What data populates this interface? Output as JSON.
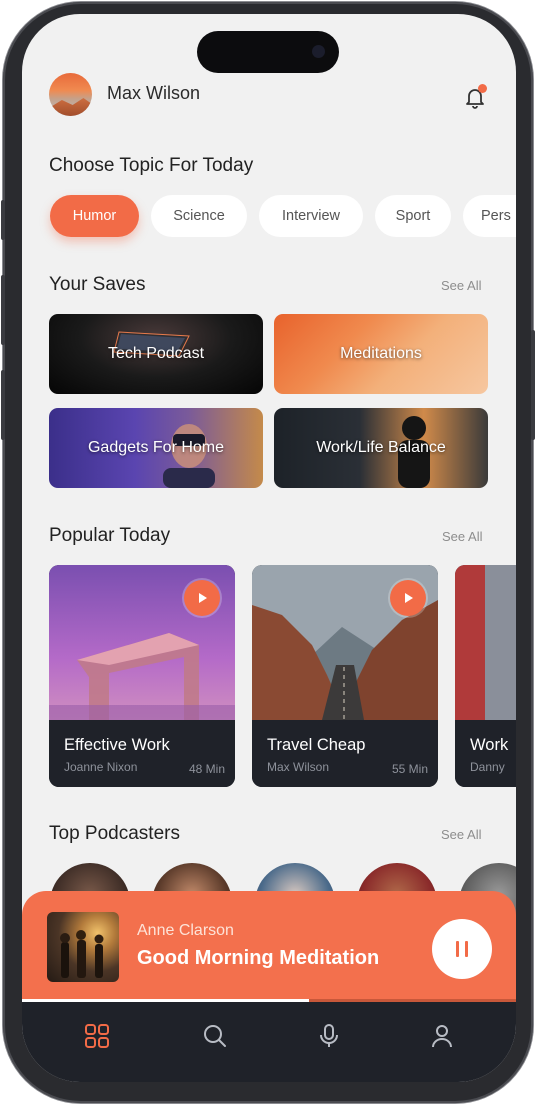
{
  "user": {
    "name": "Max Wilson"
  },
  "topics": {
    "title": "Choose Topic For Today",
    "items": [
      "Humor",
      "Science",
      "Interview",
      "Sport",
      "Pers"
    ]
  },
  "saves": {
    "title": "Your Saves",
    "see_all": "See All",
    "items": [
      "Tech Podcast",
      "Meditations",
      "Gadgets For Home",
      "Work/Life Balance"
    ]
  },
  "popular": {
    "title": "Popular Today",
    "see_all": "See All",
    "items": [
      {
        "title": "Effective Work",
        "author": "Joanne Nixon",
        "duration": "48 Min"
      },
      {
        "title": "Travel Cheap",
        "author": "Max Wilson",
        "duration": "55 Min"
      },
      {
        "title": "Work",
        "author": "Danny",
        "duration": ""
      }
    ]
  },
  "podcasters": {
    "title": "Top Podcasters",
    "see_all": "See All"
  },
  "player": {
    "artist": "Anne Clarson",
    "title": "Good Morning Meditation",
    "progress": 0.58
  },
  "tabs": [
    "grid-icon",
    "search-icon",
    "microphone-icon",
    "profile-icon"
  ],
  "colors": {
    "accent": "#f26b47",
    "dark": "#1f2229",
    "background": "#f1f1f1"
  }
}
